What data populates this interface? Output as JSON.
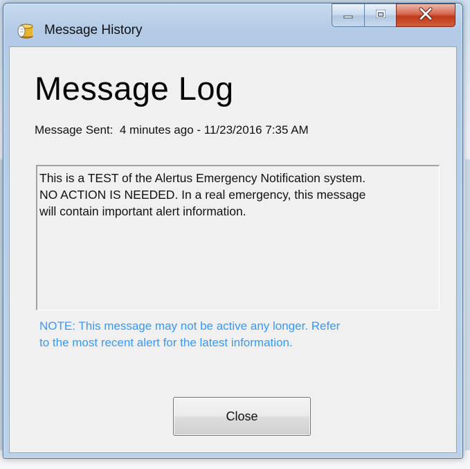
{
  "window": {
    "title": "Message History",
    "icon": "coins-stack-icon",
    "controls": {
      "minimize": "minimize-icon",
      "maximize": "maximize-icon",
      "close": "close-x-icon"
    }
  },
  "content": {
    "heading": "Message Log",
    "sent_label": "Message Sent:",
    "sent_relative": "4 minutes ago",
    "sent_separator": " - ",
    "sent_datetime": "11/23/2016 7:35 AM",
    "message_lines": [
      "This is a TEST of the Alertus Emergency Notification system.",
      "NO ACTION IS NEEDED.  In a real emergency, this message",
      "will contain important alert information."
    ],
    "note_lines": [
      "NOTE: This message may not be active any longer.  Refer",
      "to the most recent alert for the latest information."
    ],
    "close_button": "Close"
  },
  "colors": {
    "note_text": "#3399ff",
    "close_button_red": "#c03a1c",
    "titlebar": "#b3cbe6"
  }
}
